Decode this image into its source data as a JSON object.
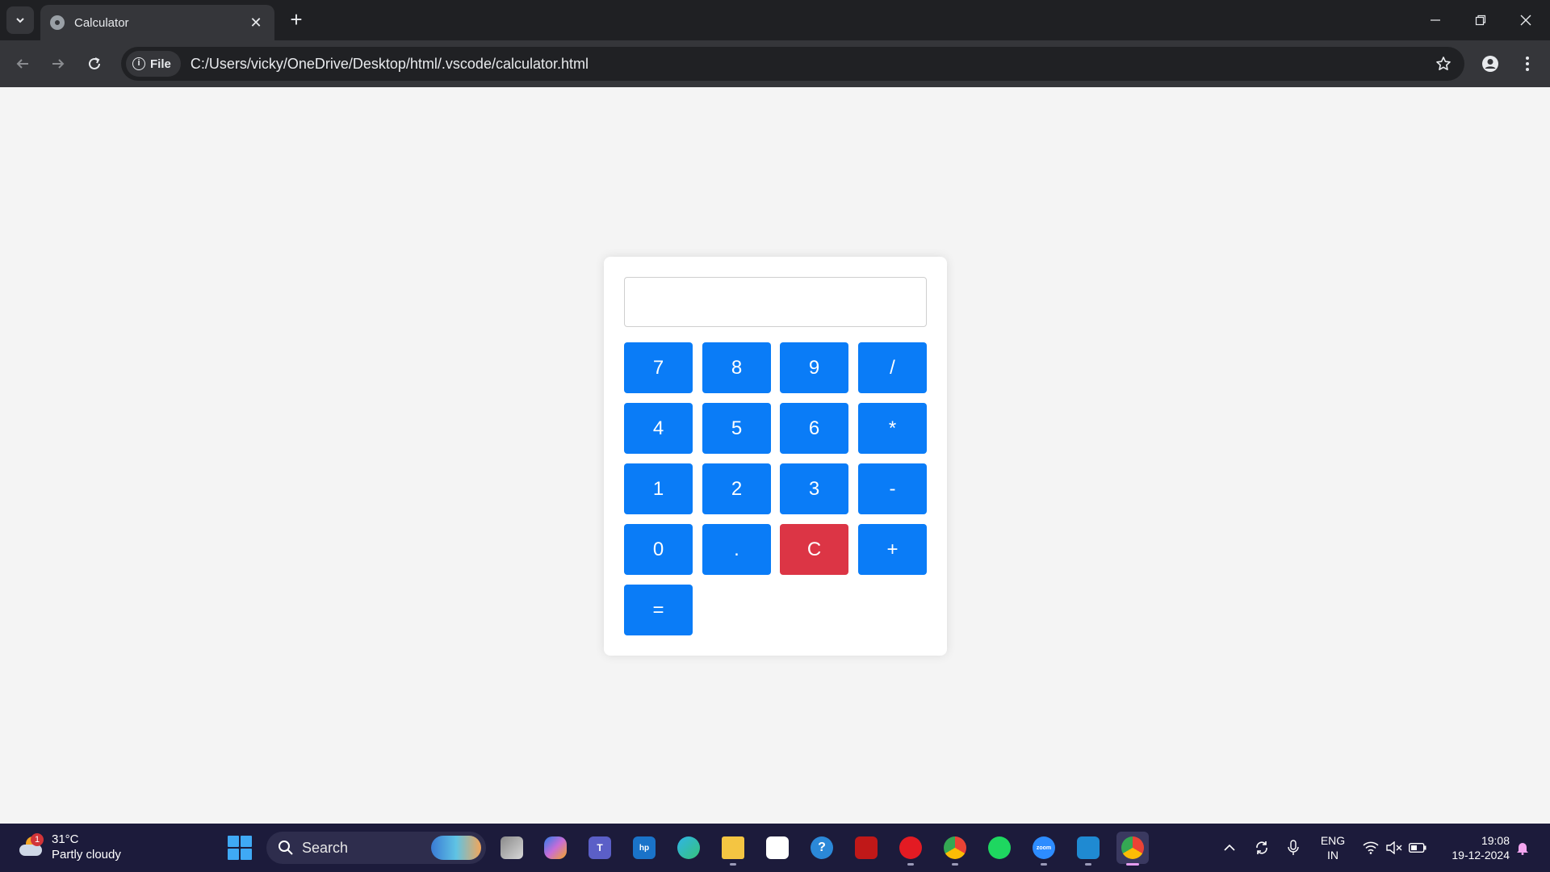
{
  "browser": {
    "tab_title": "Calculator",
    "tab_close": "✕",
    "new_tab": "+",
    "site_chip": "File",
    "url": "C:/Users/vicky/OneDrive/Desktop/html/.vscode/calculator.html"
  },
  "calculator": {
    "display_value": "",
    "keys": [
      "7",
      "8",
      "9",
      "/",
      "4",
      "5",
      "6",
      "*",
      "1",
      "2",
      "3",
      "-",
      "0",
      ".",
      "C",
      "+",
      "="
    ],
    "accent_color": "#0a7cf7",
    "clear_color": "#dc3545"
  },
  "taskbar": {
    "weather_temp": "31°C",
    "weather_desc": "Partly cloudy",
    "weather_badge": "1",
    "search_label": "Search",
    "lang_line1": "ENG",
    "lang_line2": "IN",
    "time": "19:08",
    "date": "19-12-2024"
  }
}
